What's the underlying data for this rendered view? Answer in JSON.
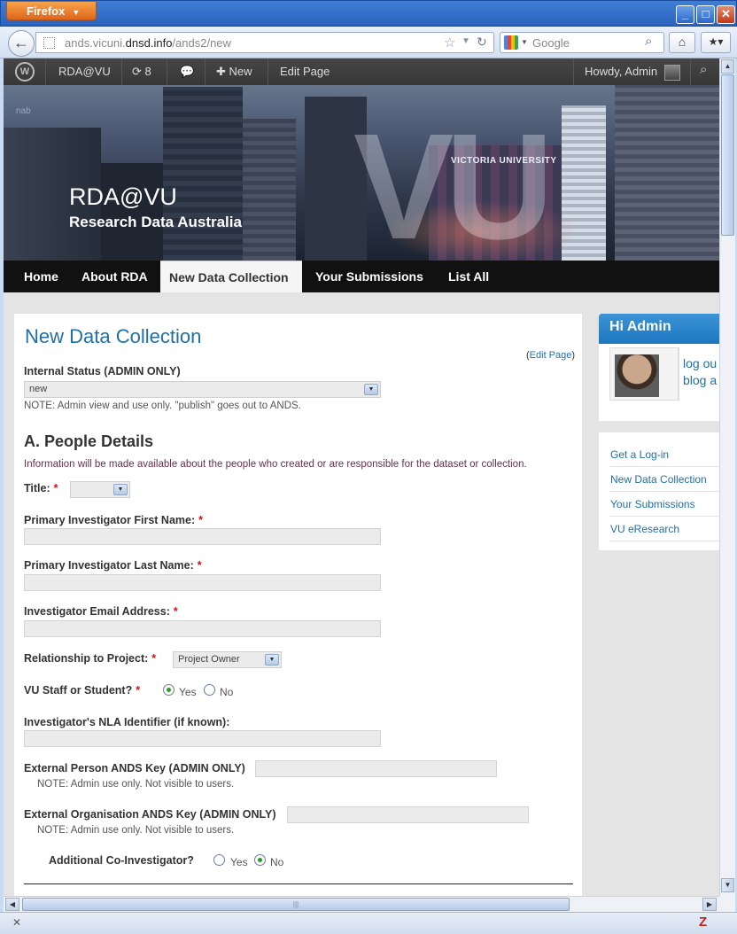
{
  "browser": {
    "app_button": "Firefox",
    "url_prefix": "ands.vicuni.",
    "url_domain": "dnsd.info",
    "url_path": "/ands2/new",
    "search_placeholder": "Google"
  },
  "adminbar": {
    "site_name": "RDA@VU",
    "updates_count": "8",
    "new_label": "New",
    "edit_page_label": "Edit Page",
    "howdy": "Howdy, Admin"
  },
  "header": {
    "title": "RDA@VU",
    "subtitle": "Research Data Australia",
    "banner_text": "VICTORIA UNIVERSITY",
    "banner_letters": "VU",
    "nab": "nab"
  },
  "menu": {
    "items": [
      "Home",
      "About RDA",
      "New Data Collection",
      "Your Submissions",
      "List All"
    ],
    "active": "New Data Collection"
  },
  "form": {
    "page_title": "New Data Collection",
    "edit_page": "Edit Page",
    "internal_status_label": "Internal Status (ADMIN ONLY)",
    "internal_status_value": "new",
    "internal_status_note": "NOTE: Admin view and use only. \"publish\" goes out to ANDS.",
    "section_title": "A. People Details",
    "section_desc": "Information will be made available about the people who created or are responsible for the dataset or collection.",
    "title_label": "Title:",
    "first_name_label": "Primary Investigator First Name:",
    "last_name_label": "Primary Investigator Last Name:",
    "email_label": "Investigator Email Address:",
    "relationship_label": "Relationship to Project:",
    "relationship_value": "Project Owner",
    "staff_label": "VU Staff or Student?",
    "yes": "Yes",
    "no": "No",
    "staff_selected": "Yes",
    "nla_label": "Investigator's NLA Identifier (if known):",
    "ext_person_label": "External Person ANDS Key (ADMIN ONLY)",
    "ext_person_note": "NOTE: Admin use only. Not visible to users.",
    "ext_org_label": "External Organisation ANDS Key (ADMIN ONLY)",
    "ext_org_note": "NOTE: Admin use only. Not visible to users.",
    "co_investigator_label": "Additional Co-Investigator?",
    "co_investigator_selected": "No",
    "required_mark": "*"
  },
  "sidebar": {
    "greeting": "Hi Admin",
    "logout": "log ou",
    "blog": "blog a",
    "links": [
      "Get a Log-in",
      "New Data Collection",
      "Your Submissions",
      "VU eResearch"
    ]
  }
}
